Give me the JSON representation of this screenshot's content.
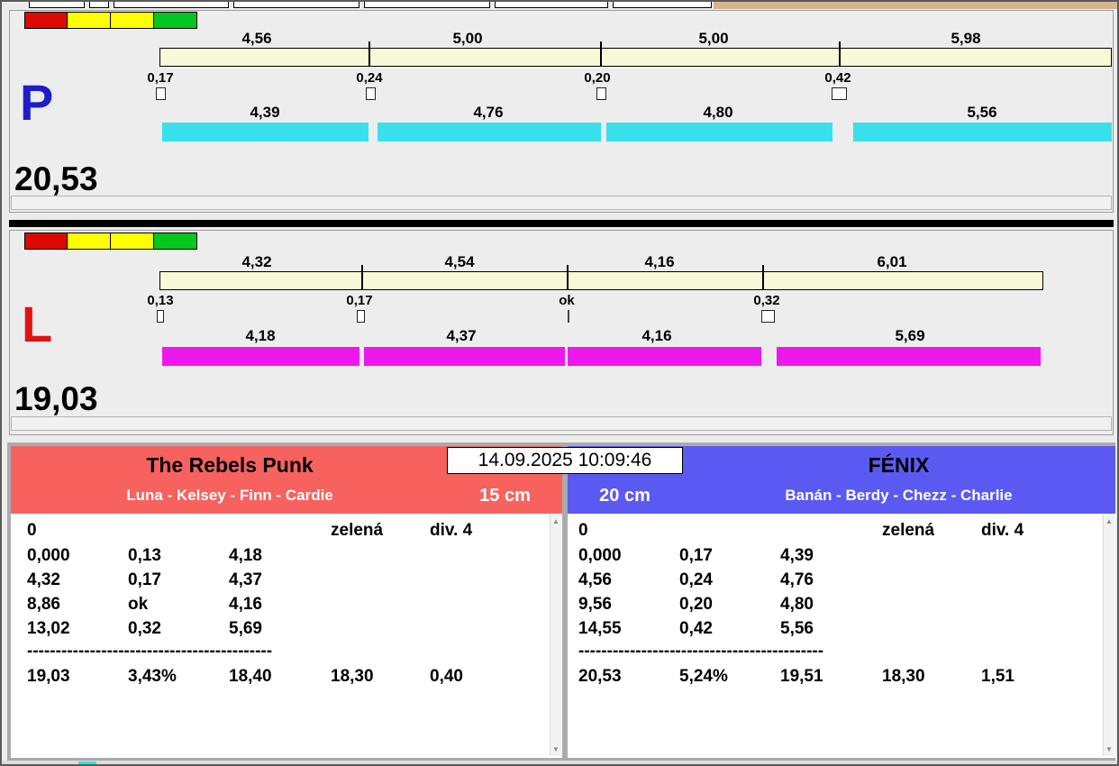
{
  "window": {
    "timestamp": "14.09.2025 10:09:46"
  },
  "icons": {
    "scroll_up": "▲",
    "scroll_down": "▼"
  },
  "lanes": [
    {
      "letter": "P",
      "total": "20,53",
      "splits": [
        "4,56",
        "5,00",
        "5,00",
        "5,98"
      ],
      "changes": [
        "0,17",
        "0,24",
        "0,20",
        "0,42"
      ],
      "legs": [
        "4,39",
        "4,76",
        "4,80",
        "5,56"
      ]
    },
    {
      "letter": "L",
      "total": "19,03",
      "splits": [
        "4,32",
        "4,54",
        "4,16",
        "6,01"
      ],
      "changes": [
        "0,13",
        "0,17",
        "ok",
        "0,32"
      ],
      "legs": [
        "4,18",
        "4,37",
        "4,16",
        "5,69"
      ]
    }
  ],
  "teams": [
    {
      "name": "The Rebels Punk",
      "dogs": "Luna - Kelsey - Finn - Cardie",
      "height": "15 cm",
      "rows": [
        [
          "0",
          "",
          "",
          "zelená",
          "div. 4"
        ],
        [
          "0,000",
          "0,13",
          "4,18",
          "",
          ""
        ],
        [
          "4,32",
          "0,17",
          "4,37",
          "",
          ""
        ],
        [
          "8,86",
          "ok",
          "4,16",
          "",
          ""
        ],
        [
          "13,02",
          "0,32",
          "5,69",
          "",
          ""
        ]
      ],
      "separator": "-------------------------------------------",
      "total_row": [
        "19,03",
        "3,43%",
        "18,40",
        "18,30",
        "0,40"
      ]
    },
    {
      "name": "FÉNIX",
      "dogs": "Banán - Berdy - Chezz - Charlie",
      "height": "20 cm",
      "rows": [
        [
          "0",
          "",
          "",
          "zelená",
          "div. 4"
        ],
        [
          "0,000",
          "0,17",
          "4,39",
          "",
          ""
        ],
        [
          "4,56",
          "0,24",
          "4,76",
          "",
          ""
        ],
        [
          "9,56",
          "0,20",
          "4,80",
          "",
          ""
        ],
        [
          "14,55",
          "0,42",
          "5,56",
          "",
          ""
        ]
      ],
      "separator": "-------------------------------------------",
      "total_row": [
        "20,53",
        "5,24%",
        "19,51",
        "18,30",
        "1,51"
      ]
    }
  ],
  "colors": {
    "lane_p_bar": "#38e0ec",
    "lane_l_bar": "#ee18ee",
    "split_bar": "#fbf8d8",
    "team_left_header": "#f7625e",
    "team_right_header": "#5a5af3",
    "lane_p_letter": "#1d1dcb",
    "lane_l_letter": "#e11212",
    "topbar_right": "#d6b48e",
    "traffic": [
      "#dd0802",
      "#ffff00",
      "#ffff00",
      "#00c81e"
    ]
  }
}
